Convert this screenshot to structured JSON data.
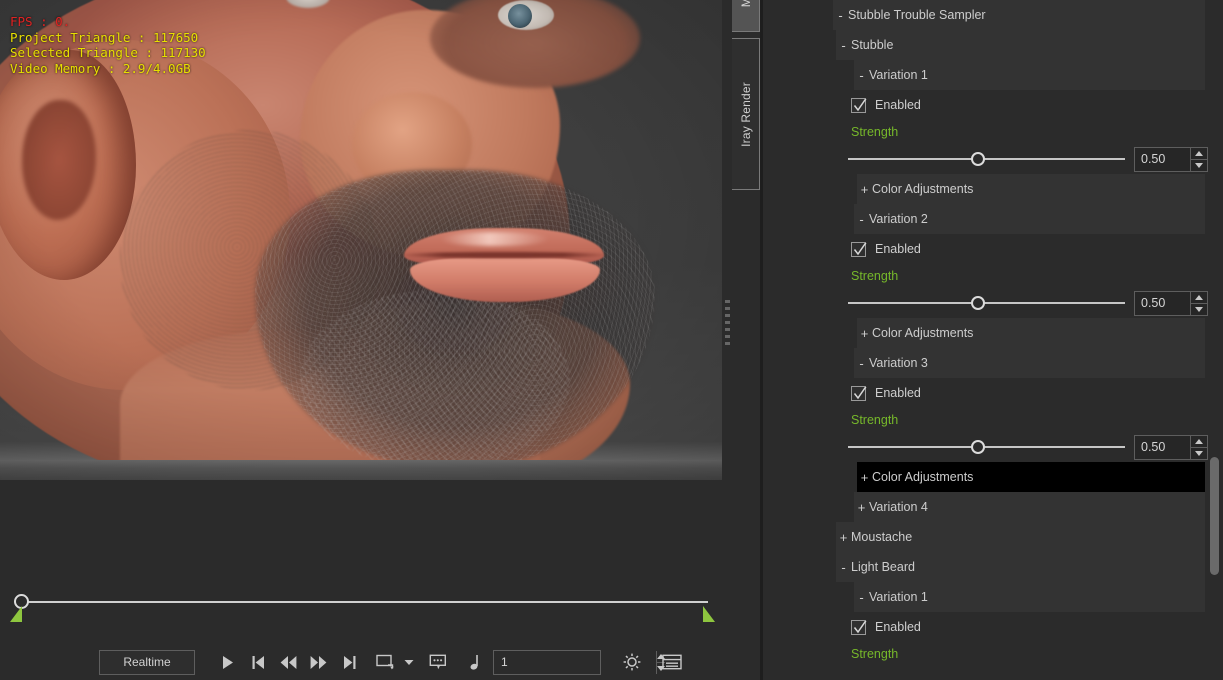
{
  "viewport": {
    "hud": {
      "fps": "FPS : 0.",
      "project_triangle": "Project Triangle : 117650",
      "selected_triangle": "Selected Triangle : 117130",
      "video_memory": "Video Memory : 2.9/4.0GB"
    },
    "corner_button_icon": "comment-bubble-icon"
  },
  "tabs": [
    {
      "label": "M",
      "icon": "tab-handle-icon"
    },
    {
      "label": "Iray Render",
      "icon": "render-tab-icon"
    }
  ],
  "timeline": {
    "current_frame_handle": "playhead",
    "range_start_marker": "range-start",
    "range_end_marker": "range-end"
  },
  "toolbar": {
    "realtime_label": "Realtime",
    "frame_value": "1",
    "buttons": [
      {
        "name": "play-button",
        "icon": "play-icon"
      },
      {
        "name": "skip-to-start-button",
        "icon": "skip-start-icon"
      },
      {
        "name": "rewind-button",
        "icon": "rewind-icon"
      },
      {
        "name": "fast-forward-button",
        "icon": "fast-forward-icon"
      },
      {
        "name": "skip-to-end-button",
        "icon": "skip-end-icon"
      },
      {
        "name": "render-region-button",
        "icon": "render-rect-icon"
      },
      {
        "name": "render-region-dropdown",
        "icon": "chevron-down-icon"
      },
      {
        "name": "comment-button",
        "icon": "comment-bubble-icon"
      },
      {
        "name": "keyframe-button",
        "icon": "music-note-icon"
      },
      {
        "name": "brightness-button",
        "icon": "sun-icon"
      },
      {
        "name": "layout-button",
        "icon": "list-layout-icon"
      }
    ]
  },
  "colors": {
    "accent_green": "#76b82a",
    "marker_green": "#8ec63f",
    "row_bg": "#333333",
    "row_selected_bg": "#000000",
    "panel_bg": "#2b2b2b",
    "hud_red": "#e02222",
    "hud_yellow": "#e8e000"
  },
  "property_panel": {
    "rows": [
      {
        "type": "group",
        "level": 0,
        "twisty": "-",
        "label": "Stubble Trouble Sampler",
        "selected": false
      },
      {
        "type": "group",
        "level": 1,
        "twisty": "-",
        "label": "Stubble",
        "selected": false
      },
      {
        "type": "group",
        "level": 2,
        "twisty": "-",
        "label": "Variation 1",
        "selected": false
      },
      {
        "type": "checkbox",
        "label": "Enabled",
        "checked": true
      },
      {
        "type": "label",
        "label": "Strength"
      },
      {
        "type": "slider",
        "value": "0.50",
        "position_pct": 47
      },
      {
        "type": "group",
        "level": 3,
        "twisty": "+",
        "label": "Color Adjustments",
        "selected": false
      },
      {
        "type": "group",
        "level": 2,
        "twisty": "-",
        "label": "Variation 2",
        "selected": false
      },
      {
        "type": "checkbox",
        "label": "Enabled",
        "checked": true
      },
      {
        "type": "label",
        "label": "Strength"
      },
      {
        "type": "slider",
        "value": "0.50",
        "position_pct": 47
      },
      {
        "type": "group",
        "level": 3,
        "twisty": "+",
        "label": "Color Adjustments",
        "selected": false
      },
      {
        "type": "group",
        "level": 2,
        "twisty": "-",
        "label": "Variation 3",
        "selected": false
      },
      {
        "type": "checkbox",
        "label": "Enabled",
        "checked": true
      },
      {
        "type": "label",
        "label": "Strength"
      },
      {
        "type": "slider",
        "value": "0.50",
        "position_pct": 47
      },
      {
        "type": "group",
        "level": 3,
        "twisty": "+",
        "label": "Color Adjustments",
        "selected": true
      },
      {
        "type": "group",
        "level": 2,
        "twisty": "+",
        "label": "Variation 4",
        "selected": false
      },
      {
        "type": "group",
        "level": 1,
        "twisty": "+",
        "label": "Moustache",
        "selected": false
      },
      {
        "type": "group",
        "level": 1,
        "twisty": "-",
        "label": "Light Beard",
        "selected": false
      },
      {
        "type": "group",
        "level": 2,
        "twisty": "-",
        "label": "Variation 1",
        "selected": false
      },
      {
        "type": "checkbox",
        "label": "Enabled",
        "checked": true
      },
      {
        "type": "label",
        "label": "Strength"
      }
    ]
  }
}
